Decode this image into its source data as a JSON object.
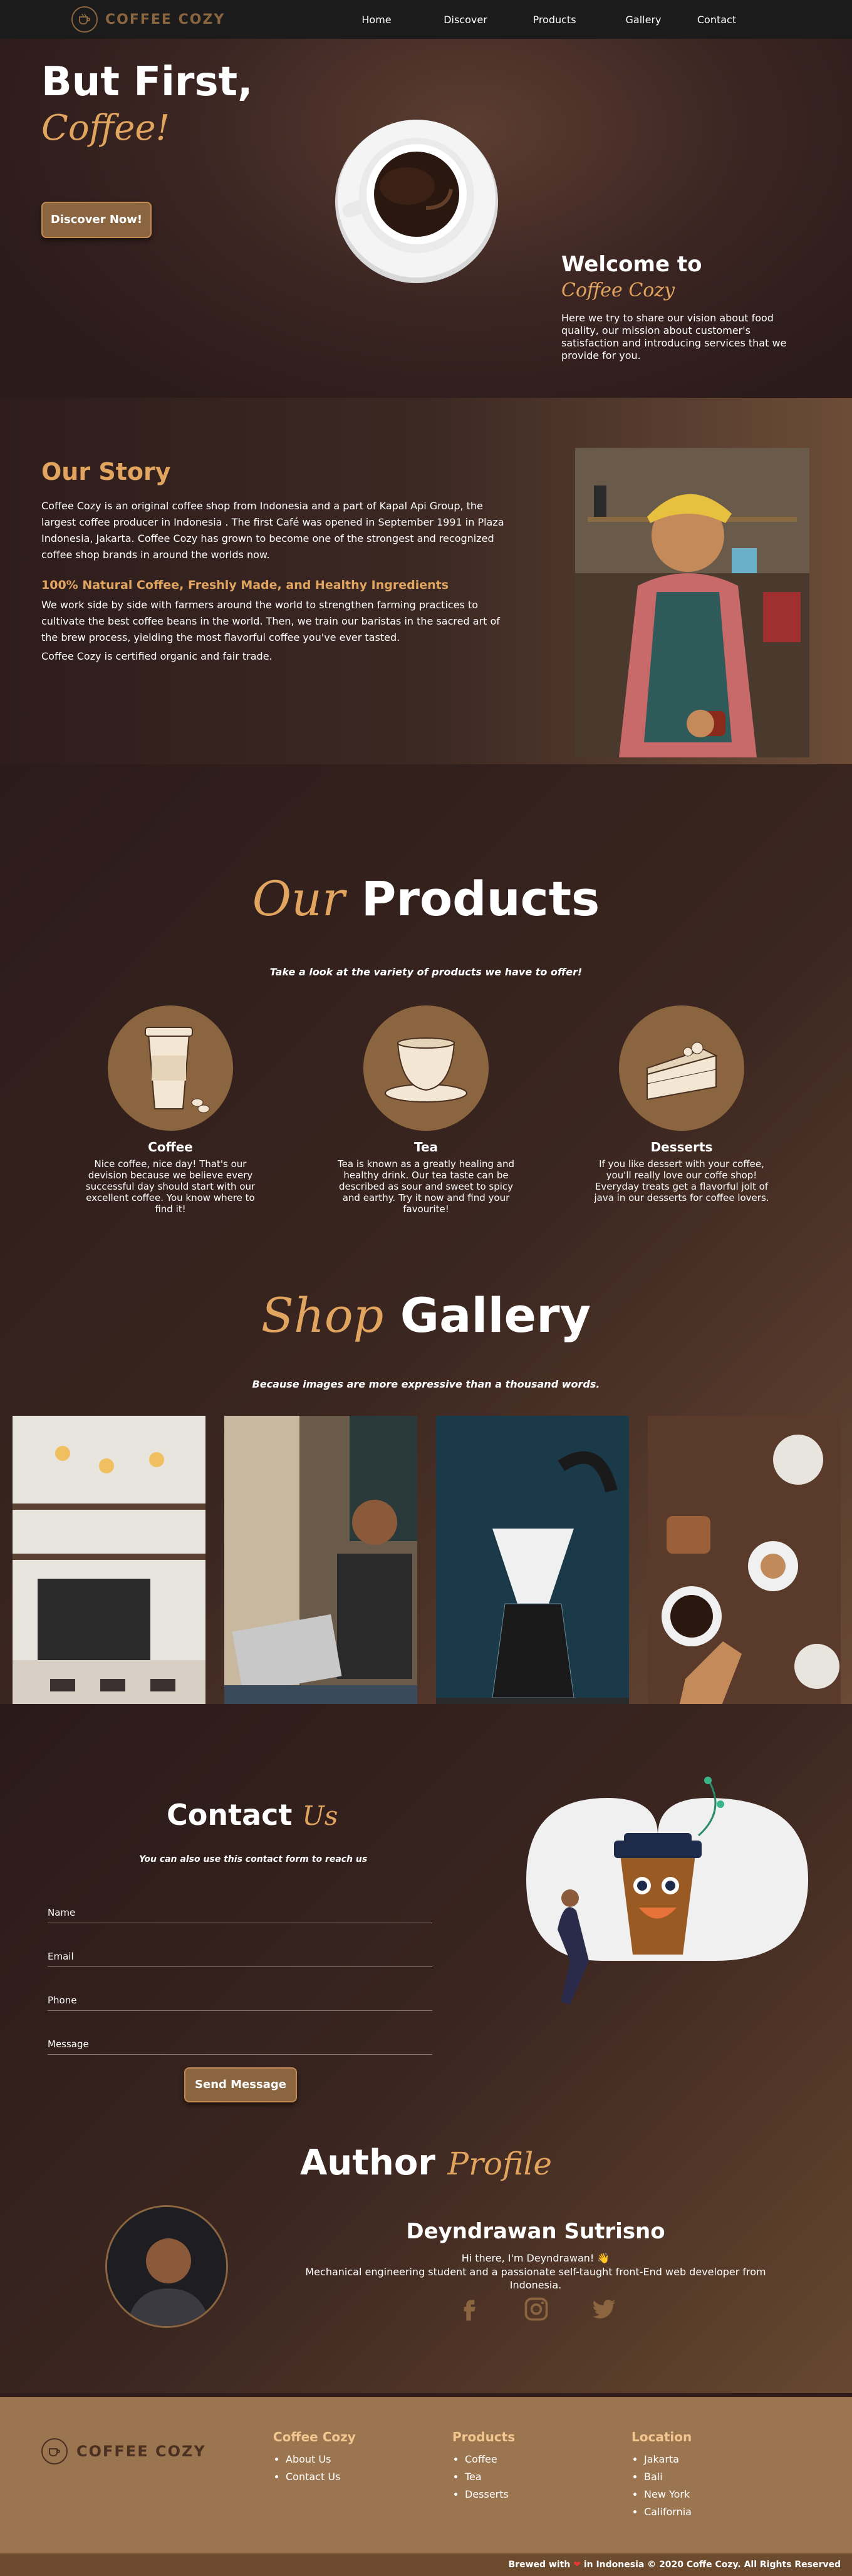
{
  "brand": {
    "name": "COFFEE COZY"
  },
  "nav": {
    "items": [
      {
        "label": "Home"
      },
      {
        "label": "Discover"
      },
      {
        "label": "Products"
      },
      {
        "label": "Gallery"
      },
      {
        "label": "Contact"
      }
    ]
  },
  "hero": {
    "title": "But First,",
    "subtitle": "Coffee!",
    "button": "Discover Now!",
    "welcome_title": "Welcome to",
    "welcome_sub": "Coffee Cozy",
    "welcome_text": "Here we try to share our vision about food quality, our mission about customer's satisfaction and introducing services that we provide for you."
  },
  "story": {
    "title": "Our Story",
    "para1": "Coffee Cozy is an original coffee shop from Indonesia and a part of Kapal Api Group, the largest coffee producer in Indonesia . The first Café was opened in September 1991 in Plaza Indonesia, Jakarta. Coffee Cozy has grown to become one of the strongest and recognized coffee shop brands in around the worlds now.",
    "subtitle": "100% Natural Coffee, Freshly Made, and Healthy Ingredients",
    "para2": "We work side by side with farmers around the world to strengthen farming practices to cultivate the best coffee beans in the world. Then, we train our baristas in the sacred art of the brew process, yielding the most flavorful coffee you've ever tasted.",
    "para3": "Coffee Cozy is certified organic and fair trade."
  },
  "products": {
    "title_script": "Our",
    "title": "Products",
    "tagline": "Take a look at the variety of products we have to offer!",
    "items": [
      {
        "name": "Coffee",
        "desc": "Nice coffee, nice day! That's our devision because we believe every successful day should start with our excellent coffee. You know where to find it!"
      },
      {
        "name": "Tea",
        "desc": "Tea is known as a greatly healing and healthy drink. Our tea taste can be described as sour and sweet to spicy and earthy. Try it now and find your favourite!"
      },
      {
        "name": "Desserts",
        "desc": "If you like dessert with your coffee, you'll really love our coffe shop! Everyday treats get a flavorful jolt of java in our desserts for coffee lovers."
      }
    ]
  },
  "gallery": {
    "title_script": "Shop",
    "title": "Gallery",
    "tagline": "Because images are more expressive than a thousand words."
  },
  "contact": {
    "title": "Contact",
    "title_script": "Us",
    "tagline": "You can also use this contact form to reach us",
    "fields": [
      {
        "label": "Name"
      },
      {
        "label": "Email"
      },
      {
        "label": "Phone"
      },
      {
        "label": "Message"
      }
    ],
    "button": "Send Message"
  },
  "author": {
    "title": "Author",
    "title_script": "Profile",
    "name": "Deyndrawan Sutrisno",
    "greeting": "Hi there, I'm Deyndrawan! 👋",
    "bio": "Mechanical engineering student and a passionate self-taught front-End web developer from Indonesia."
  },
  "footer": {
    "brand": "COFFEE COZY",
    "columns": [
      {
        "title": "Coffee Cozy",
        "items": [
          "About Us",
          "Contact Us"
        ]
      },
      {
        "title": "Products",
        "items": [
          "Coffee",
          "Tea",
          "Desserts"
        ]
      },
      {
        "title": "Location",
        "items": [
          "Jakarta",
          "Bali",
          "New York",
          "California"
        ]
      }
    ],
    "copyright_prefix": "Brewed with",
    "copyright_suffix": "in Indonesia © 2020 Coffe Cozy. All Rights Reserved"
  },
  "colors": {
    "accent": "#e2a55f",
    "brand_brown": "#8a6540",
    "navbar": "#1b1b1b",
    "footer": "#9b7450"
  }
}
